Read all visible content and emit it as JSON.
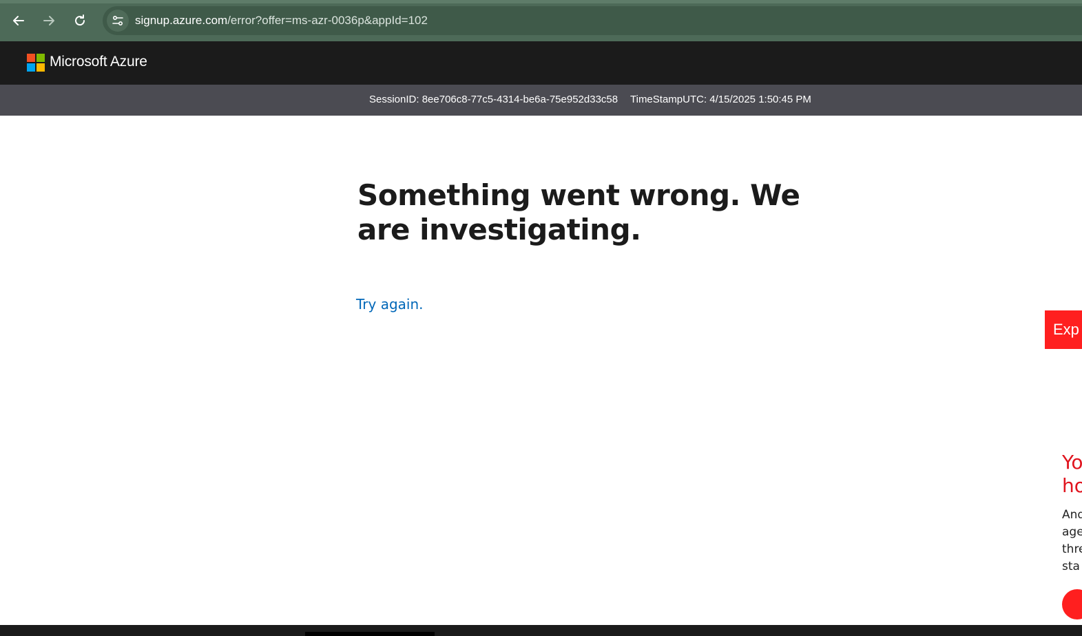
{
  "browser": {
    "url_host": "signup.azure.com",
    "url_path": "/error?offer=ms-azr-0036p&appId=102",
    "icons": {
      "back": "arrow-left-icon",
      "forward": "arrow-right-icon",
      "reload": "reload-icon",
      "site_info": "tune-icon"
    }
  },
  "header": {
    "brand": "Microsoft Azure",
    "logo_colors": [
      "#f25022",
      "#7fba00",
      "#00a4ef",
      "#ffb900"
    ]
  },
  "session": {
    "session_id": "SessionID: 8ee706c8-77c5-4314-be6a-75e952d33c58",
    "timestamp": "TimeStampUTC: 4/15/2025 1:50:45 PM"
  },
  "main": {
    "error_title": "Something went wrong. We are investigating.",
    "try_again": "Try again."
  },
  "overlay": {
    "tab_label": "Exp",
    "heading_line1": "Yo",
    "heading_line2": "ho",
    "text_lines": [
      "And",
      "age",
      "thre",
      "sta"
    ],
    "accent_color": "#ff1f1f"
  }
}
